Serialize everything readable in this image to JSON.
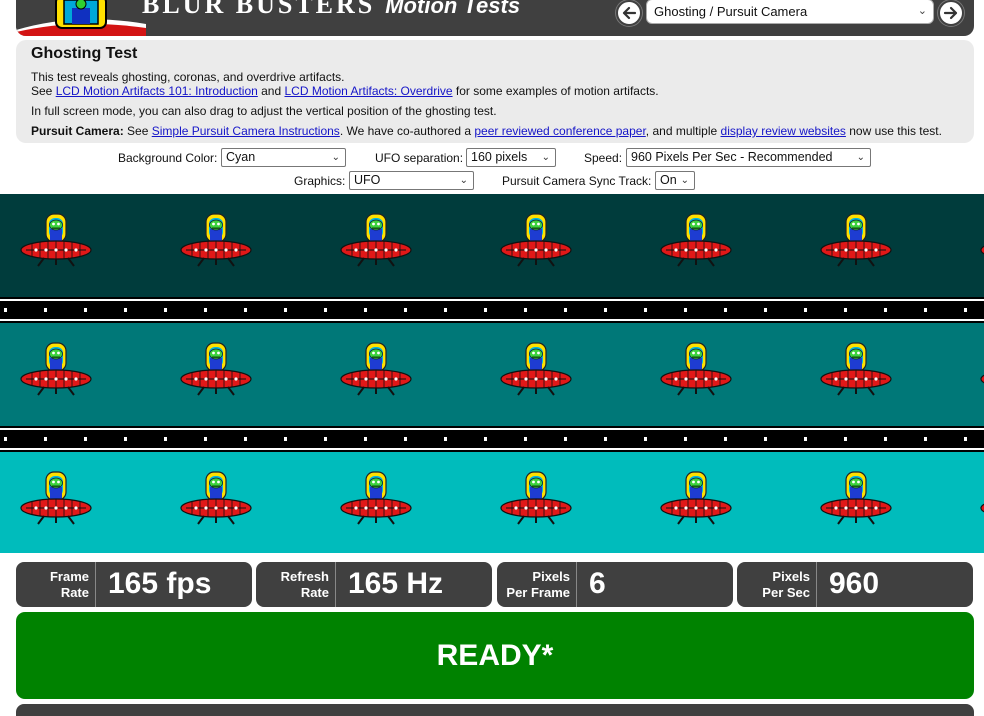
{
  "header": {
    "brand_main": "BLUR BUSTERS",
    "brand_sub": "Motion Tests",
    "test_select_value": "Ghosting / Pursuit Camera"
  },
  "info": {
    "title": "Ghosting Test",
    "line1": "This test reveals ghosting, coronas, and overdrive artifacts.",
    "line2_see": "See ",
    "link_intro": "LCD Motion Artifacts 101: Introduction",
    "line2_and": " and ",
    "link_overdrive": "LCD Motion Artifacts: Overdrive",
    "line2_tail": " for some examples of motion artifacts.",
    "line3": "In full screen mode, you can also drag to adjust the vertical position of the ghosting test.",
    "pursuit_label": "Pursuit Camera:",
    "pursuit_see": " See ",
    "link_pursuit": "Simple Pursuit Camera Instructions",
    "pursuit_mid": ". We have co-authored a ",
    "link_paper": "peer reviewed conference paper",
    "pursuit_mid2": ", and multiple ",
    "link_reviews": "display review websites",
    "pursuit_tail": " now use this test."
  },
  "controls": {
    "bg_label": "Background Color:",
    "bg_value": "Cyan",
    "sep_label": "UFO separation:",
    "sep_value": "160 pixels",
    "speed_label": "Speed:",
    "speed_value": "960 Pixels Per Sec - Recommended",
    "graphics_label": "Graphics:",
    "graphics_value": "UFO",
    "sync_label": "Pursuit Camera Sync Track:",
    "sync_value": "On"
  },
  "lanes": [
    {
      "name": "dark",
      "color": "#003c3c"
    },
    {
      "name": "medium",
      "color": "#007878"
    },
    {
      "name": "light",
      "color": "#00bcbc"
    }
  ],
  "stats": [
    {
      "label1": "Frame",
      "label2": "Rate",
      "value": "165 fps"
    },
    {
      "label1": "Refresh",
      "label2": "Rate",
      "value": "165 Hz"
    },
    {
      "label1": "Pixels",
      "label2": "Per Frame",
      "value": "6"
    },
    {
      "label1": "Pixels",
      "label2": "Per Sec",
      "value": "960"
    }
  ],
  "status": {
    "ready_text": "READY*"
  },
  "colors": {
    "panel_dark": "#404040",
    "ready_green": "#008200",
    "link_blue": "#1515c8"
  }
}
